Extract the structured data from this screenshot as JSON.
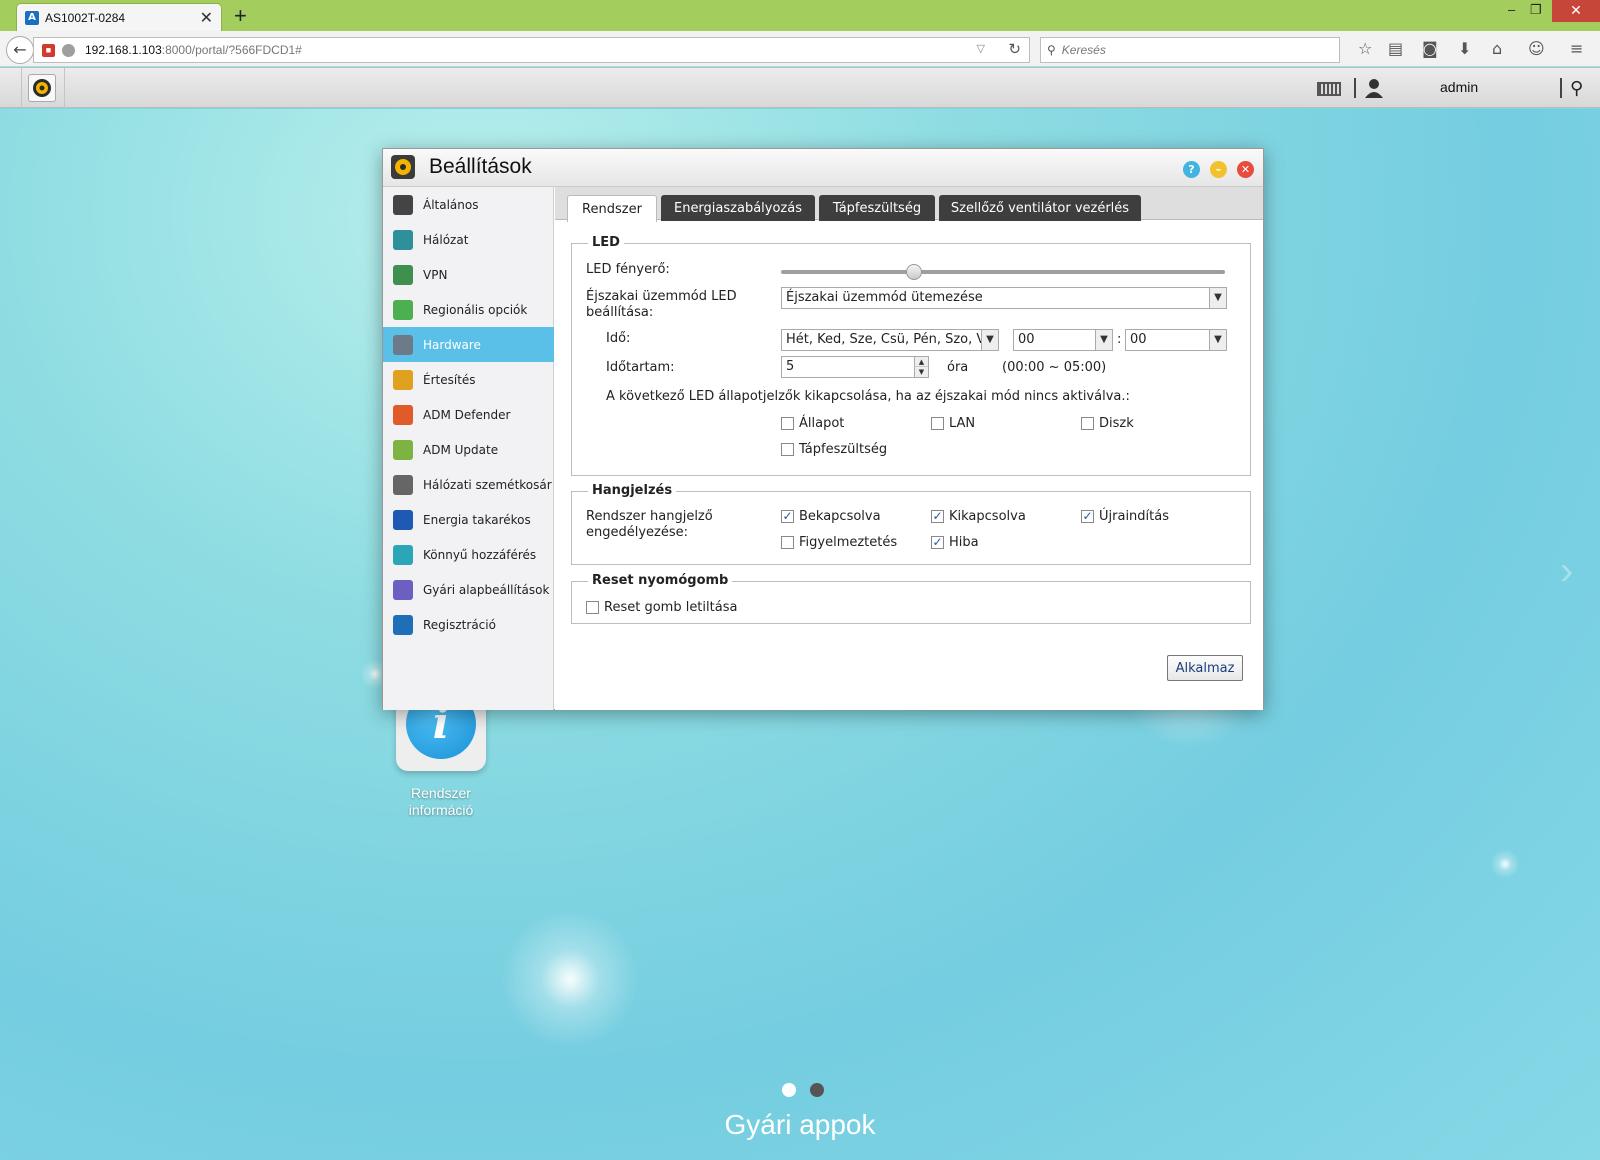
{
  "browser": {
    "tab_title": "AS1002T-0284",
    "tab_close": "✕",
    "new_tab": "+",
    "url_host": "192.168.1.103",
    "url_path": ":8000/portal/?566FDCD1#",
    "search_placeholder": "Keresés",
    "window_minimize": "–",
    "window_restore": "❐",
    "window_close": "✕"
  },
  "admbar": {
    "user": "admin"
  },
  "desktop": {
    "sysinfo_label_line1": "Rendszer",
    "sysinfo_label_line2": "információ",
    "sysinfo_glyph": "i",
    "caption": "Gyári appok"
  },
  "window": {
    "title": "Beállítások",
    "help_glyph": "?",
    "min_glyph": "–",
    "close_glyph": "✕"
  },
  "sidebar": {
    "items": [
      {
        "label": "Általános",
        "icon": "server-icon",
        "color": "#444444"
      },
      {
        "label": "Hálózat",
        "icon": "globe-icon",
        "color": "#2f8f9a"
      },
      {
        "label": "VPN",
        "icon": "vpn-icon",
        "color": "#3f8f4f"
      },
      {
        "label": "Regionális opciók",
        "icon": "region-icon",
        "color": "#4caf50"
      },
      {
        "label": "Hardware",
        "icon": "hardware-icon",
        "color": "#6c7a89"
      },
      {
        "label": "Értesítés",
        "icon": "alert-icon",
        "color": "#e0a020"
      },
      {
        "label": "ADM Defender",
        "icon": "firewall-icon",
        "color": "#e05a2a"
      },
      {
        "label": "ADM Update",
        "icon": "update-arrow-icon",
        "color": "#7cb342"
      },
      {
        "label": "Hálózati szemétkosár",
        "icon": "trash-icon",
        "color": "#666666"
      },
      {
        "label": "Energia takarékos",
        "icon": "energy-icon",
        "color": "#1e5ab4"
      },
      {
        "label": "Könnyű hozzáférés",
        "icon": "cloud-upload-icon",
        "color": "#2aa6b8"
      },
      {
        "label": "Gyári alapbeállítások",
        "icon": "undo-icon",
        "color": "#6b5fc2"
      },
      {
        "label": "Regisztráció",
        "icon": "registration-icon",
        "color": "#1e6fb8"
      }
    ],
    "active_index": 4
  },
  "tabs": [
    "Rendszer",
    "Energiaszabályozás",
    "Tápfeszültség",
    "Szellőző ventilátor vezérlés"
  ],
  "led": {
    "legend": "LED",
    "brightness_label": "LED fényerő:",
    "brightness_level": 0.3,
    "night_mode_label_1": "Éjszakai üzemmód LED",
    "night_mode_label_2": "beállítása:",
    "night_mode_value": "Éjszakai üzemmód ütemezése",
    "time_label": "Idő:",
    "days_value": "Hét, Ked, Sze, Csü, Pén, Szo, V",
    "hour_value": "00",
    "colon": ":",
    "minute_value": "00",
    "duration_label": "Időtartam:",
    "duration_value": "5",
    "duration_unit": "óra",
    "duration_range": "(00:00 ~ 05:00)",
    "off_note": "A következő LED állapotjelzők kikapcsolása, ha az éjszakai mód nincs aktiválva.:",
    "checkboxes": [
      {
        "label": "Állapot",
        "checked": false
      },
      {
        "label": "LAN",
        "checked": false
      },
      {
        "label": "Diszk",
        "checked": false
      },
      {
        "label": "Tápfeszültség",
        "checked": false
      }
    ]
  },
  "buzzer": {
    "legend": "Hangjelzés",
    "label_1": "Rendszer hangjelző",
    "label_2": "engedélyezése:",
    "checkboxes": [
      {
        "label": "Bekapcsolva",
        "checked": true
      },
      {
        "label": "Kikapcsolva",
        "checked": true
      },
      {
        "label": "Újraindítás",
        "checked": true
      },
      {
        "label": "Figyelmeztetés",
        "checked": false
      },
      {
        "label": "Hiba",
        "checked": true
      }
    ]
  },
  "reset": {
    "legend": "Reset nyomógomb",
    "checkbox_label": "Reset gomb letiltása",
    "checked": false
  },
  "apply_label": "Alkalmaz",
  "check_glyph": "✓",
  "colors": {
    "browser_green": "#a3cd5c",
    "sidebar_active": "#5bc0e8",
    "tab_dark": "#3e3e3e",
    "close_red": "#e84c3d",
    "min_yellow": "#f2c12e",
    "help_blue": "#3fb5e0"
  }
}
